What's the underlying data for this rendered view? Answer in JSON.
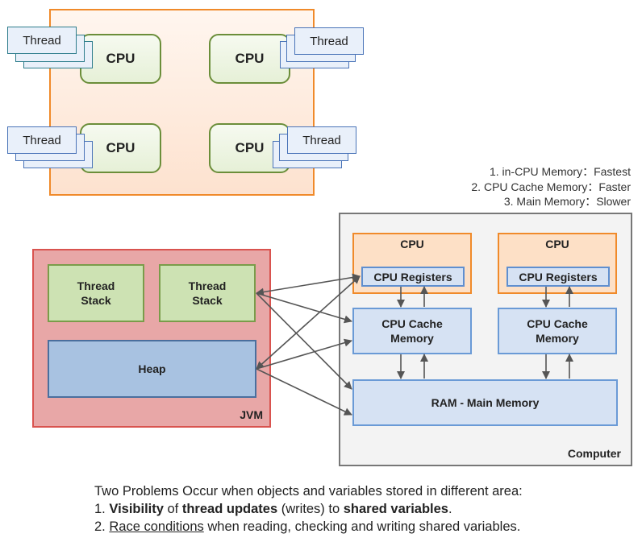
{
  "top_diagram": {
    "cpus": [
      {
        "label": "CPU"
      },
      {
        "label": "CPU"
      },
      {
        "label": "CPU"
      },
      {
        "label": "CPU"
      }
    ],
    "threads": [
      {
        "label": "Thread"
      },
      {
        "label": "Thread"
      },
      {
        "label": "Thread"
      },
      {
        "label": "Thread"
      }
    ]
  },
  "legend": {
    "items": [
      "1. in-CPU Memory：Fastest",
      "2. CPU Cache Memory：Faster",
      "3. Main Memory：Slower"
    ]
  },
  "jvm": {
    "label": "JVM",
    "stacks": [
      {
        "line1": "Thread",
        "line2": "Stack"
      },
      {
        "line1": "Thread",
        "line2": "Stack"
      }
    ],
    "heap": "Heap"
  },
  "computer": {
    "label": "Computer",
    "cpus": [
      {
        "label": "CPU",
        "registers": "CPU Registers",
        "cache_line1": "CPU Cache",
        "cache_line2": "Memory"
      },
      {
        "label": "CPU",
        "registers": "CPU Registers",
        "cache_line1": "CPU Cache",
        "cache_line2": "Memory"
      }
    ],
    "ram": "RAM - Main Memory"
  },
  "notes": {
    "intro": "Two Problems Occur when objects and variables stored in different area:",
    "p1_num": "1. ",
    "p1_b1": "Visibility",
    "p1_t1": " of ",
    "p1_b2": "thread updates",
    "p1_t2": " (writes) to ",
    "p1_b3": "shared variables",
    "p1_t3": ".",
    "p2_num": "2. ",
    "p2_u": "Race conditions",
    "p2_t": " when reading, checking and writing shared variables."
  },
  "colors": {
    "top_frame_border": "#f08a2a",
    "cpu_border": "#6b8e3a",
    "jvm_border": "#d9534f",
    "jvm_fill": "#e8a7a7",
    "stack_fill": "#cde2b3",
    "heap_fill": "#a8c2e1",
    "memory_fill": "#d6e2f3",
    "cpu_box_fill": "#fde0c6",
    "arrow": "#555555"
  }
}
